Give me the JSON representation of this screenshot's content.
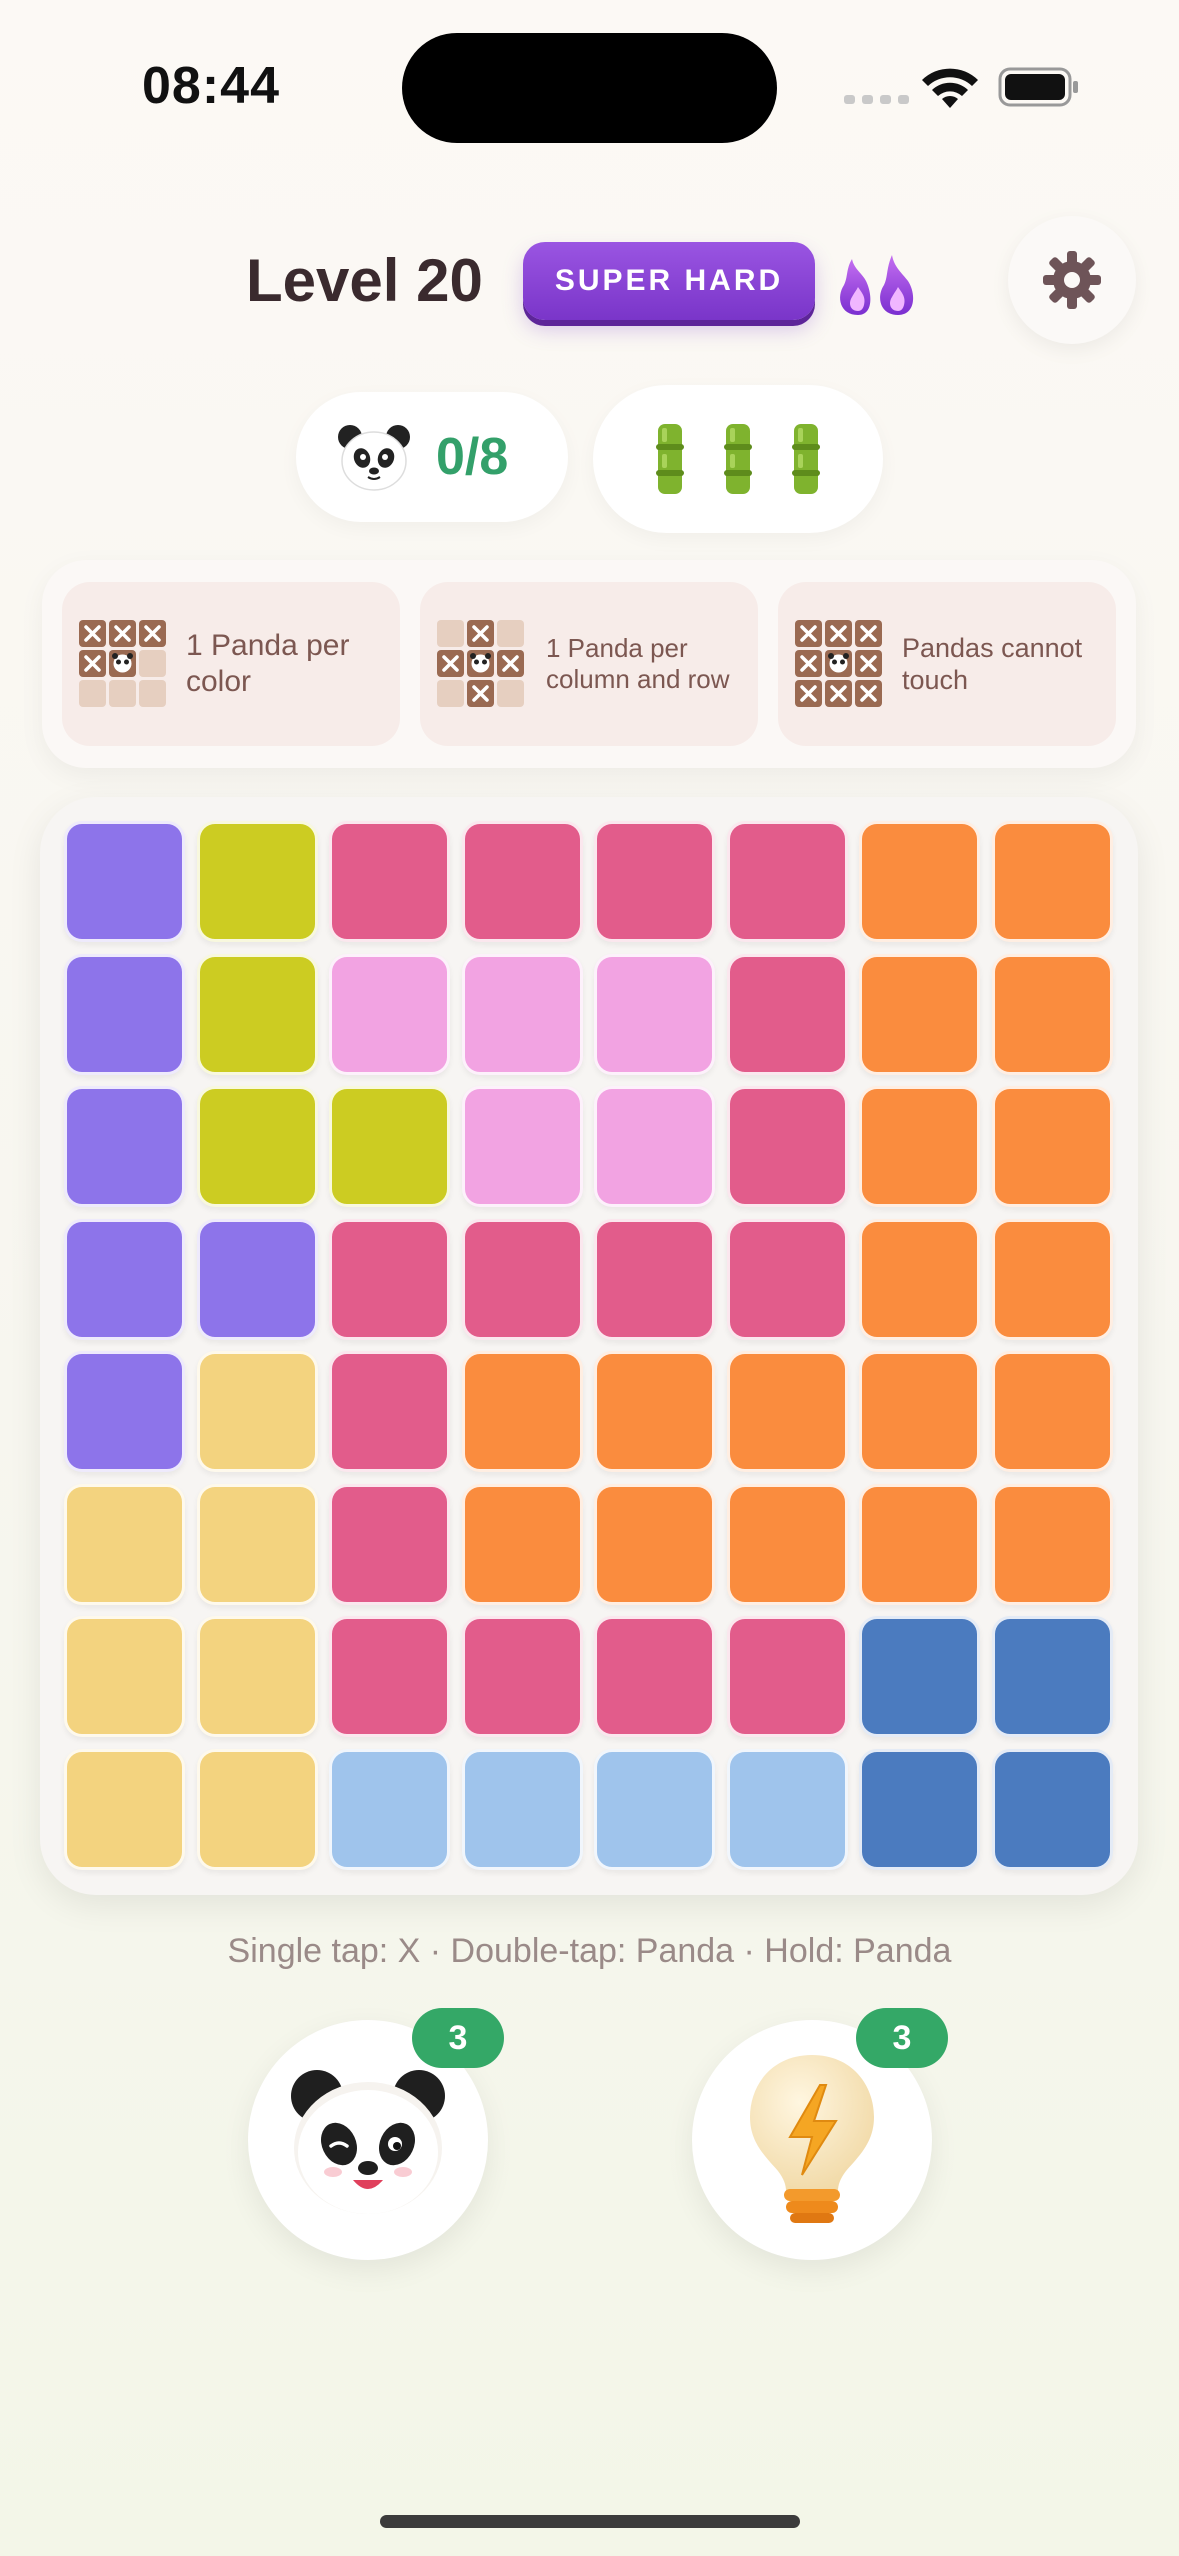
{
  "status_bar": {
    "time": "08:44"
  },
  "header": {
    "level_title": "Level 20",
    "difficulty": "SUPER HARD"
  },
  "progress": {
    "pandas_placed": "0/8",
    "bamboo_lives": 3
  },
  "rules": [
    {
      "text": "1 Panda per color"
    },
    {
      "text": "1 Panda per column and row"
    },
    {
      "text": "Pandas cannot touch"
    }
  ],
  "colors": {
    "P": "#8d74ea",
    "Y": "#cccc22",
    "R": "#e25c8b",
    "K": "#f2a3e2",
    "O": "#fa8c3e",
    "S": "#f3d37f",
    "L": "#9fc4ec",
    "B": "#4b7bbf",
    "accent_green": "#33a06a",
    "badge_purple": "#8a45d6"
  },
  "board": {
    "rows": [
      [
        "P",
        "Y",
        "R",
        "R",
        "R",
        "R",
        "O",
        "O"
      ],
      [
        "P",
        "Y",
        "K",
        "K",
        "K",
        "R",
        "O",
        "O"
      ],
      [
        "P",
        "Y",
        "Y",
        "K",
        "K",
        "R",
        "O",
        "O"
      ],
      [
        "P",
        "P",
        "R",
        "R",
        "R",
        "R",
        "O",
        "O"
      ],
      [
        "P",
        "S",
        "R",
        "O",
        "O",
        "O",
        "O",
        "O"
      ],
      [
        "S",
        "S",
        "R",
        "O",
        "O",
        "O",
        "O",
        "O"
      ],
      [
        "S",
        "S",
        "R",
        "R",
        "R",
        "R",
        "B",
        "B"
      ],
      [
        "S",
        "S",
        "L",
        "L",
        "L",
        "L",
        "B",
        "B"
      ]
    ]
  },
  "hint_text": "Single tap: X · Double-tap: Panda · Hold: Panda",
  "powerups": {
    "panda_count": "3",
    "hint_count": "3"
  }
}
